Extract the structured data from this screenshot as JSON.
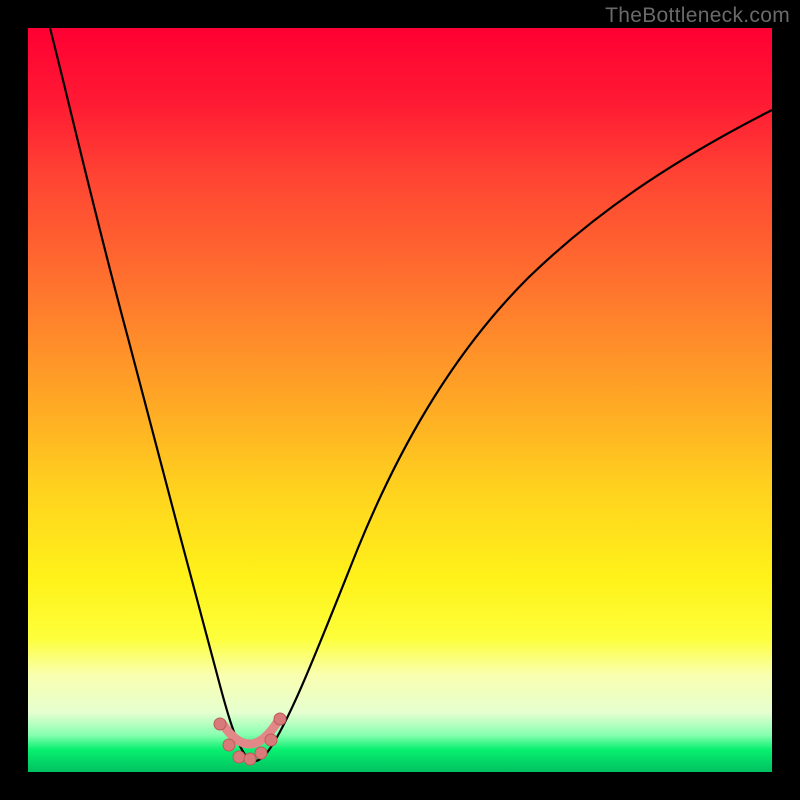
{
  "watermark": "TheBottleneck.com",
  "chart_data": {
    "type": "line",
    "title": "",
    "xlabel": "",
    "ylabel": "",
    "xlim": [
      0,
      1
    ],
    "ylim": [
      0,
      1
    ],
    "gradient_stops": [
      {
        "offset": 0.0,
        "color": "#ff0033"
      },
      {
        "offset": 0.1,
        "color": "#ff1a33"
      },
      {
        "offset": 0.2,
        "color": "#ff4433"
      },
      {
        "offset": 0.32,
        "color": "#ff6a2f"
      },
      {
        "offset": 0.42,
        "color": "#ff8c2a"
      },
      {
        "offset": 0.52,
        "color": "#ffae24"
      },
      {
        "offset": 0.62,
        "color": "#ffd21e"
      },
      {
        "offset": 0.74,
        "color": "#fff21a"
      },
      {
        "offset": 0.82,
        "color": "#fdff3a"
      },
      {
        "offset": 0.87,
        "color": "#f9ffb0"
      },
      {
        "offset": 0.92,
        "color": "#e6ffd0"
      },
      {
        "offset": 0.95,
        "color": "#88ffb0"
      },
      {
        "offset": 0.97,
        "color": "#08f070"
      },
      {
        "offset": 1.0,
        "color": "#00c060"
      }
    ],
    "series": [
      {
        "name": "curve",
        "x": [
          0.03,
          0.06,
          0.1,
          0.14,
          0.18,
          0.22,
          0.26,
          0.283,
          0.3,
          0.32,
          0.34,
          0.37,
          0.41,
          0.46,
          0.52,
          0.58,
          0.65,
          0.72,
          0.8,
          0.88,
          0.96,
          1.0
        ],
        "y": [
          1.0,
          0.88,
          0.72,
          0.56,
          0.4,
          0.24,
          0.09,
          0.02,
          0.02,
          0.04,
          0.09,
          0.18,
          0.3,
          0.42,
          0.53,
          0.62,
          0.7,
          0.76,
          0.81,
          0.85,
          0.88,
          0.895
        ]
      },
      {
        "name": "valley-dots",
        "x": [
          0.258,
          0.27,
          0.283,
          0.296,
          0.309,
          0.322,
          0.335
        ],
        "y": [
          0.064,
          0.036,
          0.02,
          0.018,
          0.026,
          0.044,
          0.072
        ]
      }
    ],
    "valley_arc": {
      "x": [
        0.26,
        0.298,
        0.336
      ],
      "y": [
        0.06,
        0.012,
        0.068
      ]
    }
  }
}
